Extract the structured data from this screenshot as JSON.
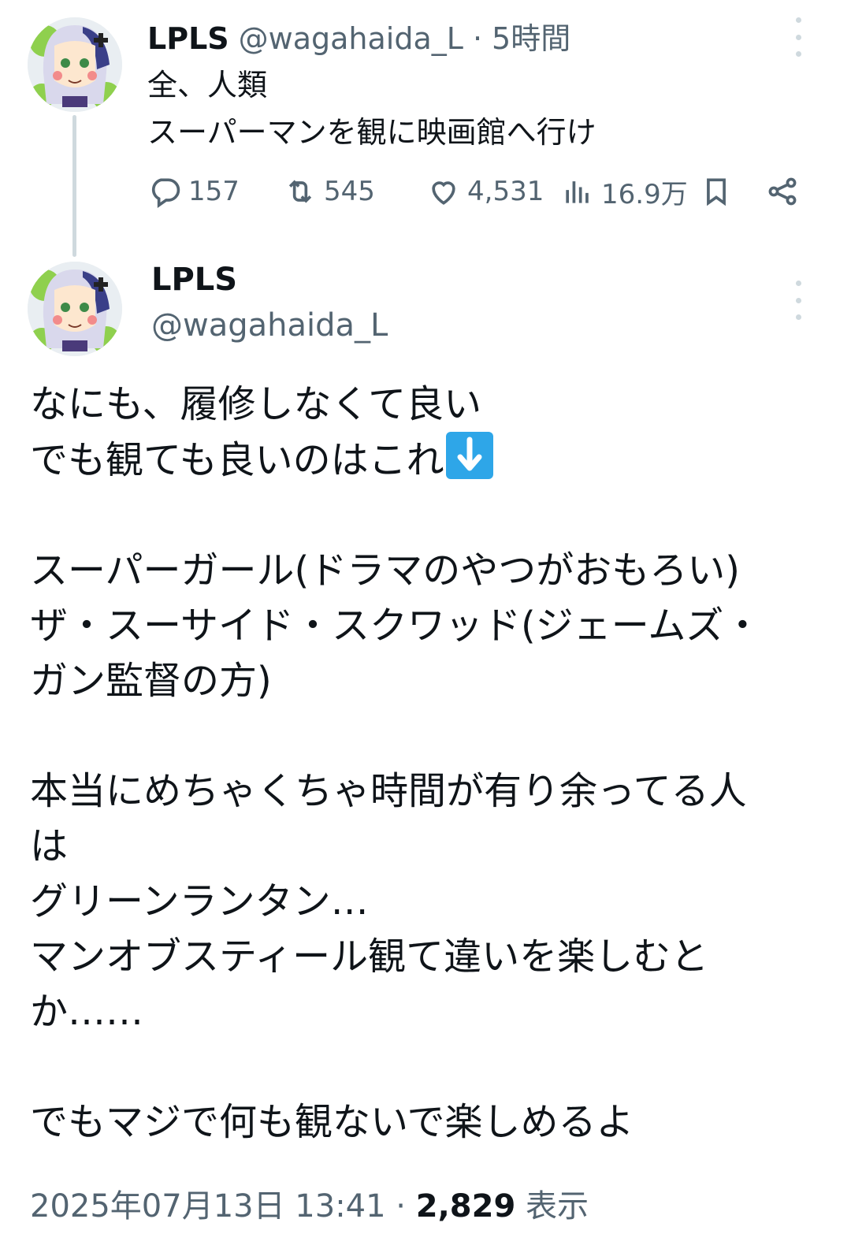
{
  "tweet1": {
    "name": "LPLS",
    "handle": "@wagahaida_L",
    "separator": "·",
    "time": "5時間",
    "lines": [
      "全、人類",
      "スーパーマンを観に映画館へ行け"
    ],
    "replies": "157",
    "retweets": "545",
    "likes": "4,531",
    "views": "16.9万"
  },
  "tweet2": {
    "name": "LPLS",
    "handle": "@wagahaida_L",
    "lines": [
      "なにも、履修しなくて良い",
      "でも観ても良いのはこれ",
      "",
      "スーパーガール(ドラマのやつがおもろい)",
      "ザ・スーサイド・スクワッド(ジェームズ・",
      "ガン監督の方)",
      "",
      "本当にめちゃくちゃ時間が有り余ってる人",
      "は",
      "グリーンランタン…",
      "マンオブスティール観て違いを楽しむと",
      "か……",
      "",
      "でもマジで何も観ないで楽しめるよ"
    ],
    "timestamp": "2025年07月13日 13:41",
    "separator": " · ",
    "view_count": "2,829",
    "view_label": " 表示"
  },
  "icons": {
    "reply": "reply-icon",
    "retweet": "retweet-icon",
    "like": "heart-icon",
    "views": "analytics-icon",
    "bookmark": "bookmark-icon",
    "share": "share-icon",
    "more": "more-vertical-icon",
    "down_arrow_emoji": "down-arrow-emoji-icon"
  },
  "colors": {
    "text": "#0f1419",
    "secondary": "#536471",
    "thread_line": "#cfd9de",
    "emoji_blue": "#2ea6e8"
  }
}
